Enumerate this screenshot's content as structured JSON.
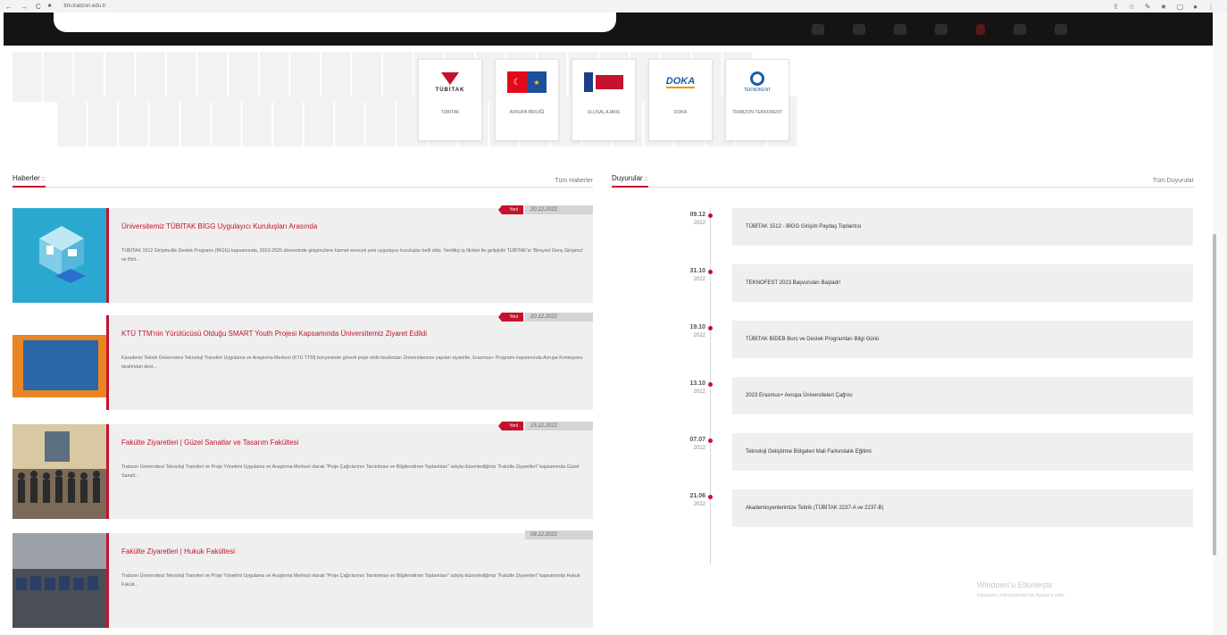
{
  "browser": {
    "back": "←",
    "forward": "→",
    "reload": "C",
    "url": "ttm.trabzon.edu.tr",
    "actions": [
      "⇪",
      "☆",
      "✎",
      "★",
      "▢",
      "●",
      "⋮"
    ]
  },
  "partners": [
    {
      "name": "tubitak",
      "logo_text": "TÜBİTAK",
      "label": "TÜBİTAK"
    },
    {
      "name": "eu",
      "logo_text": "C★",
      "label": "AVRUPA BİRLİĞİ"
    },
    {
      "name": "ua",
      "logo_text": "",
      "label": "ULUSAL AJANS"
    },
    {
      "name": "doka",
      "logo_text": "DOKA",
      "label": "DOKA"
    },
    {
      "name": "tt",
      "logo_text": "TEKNOKENT",
      "label": "TRABZON TEKNOKENT"
    }
  ],
  "news": {
    "title": "Haberler",
    "all_link": "Tüm Haberler",
    "new_label": "Yeni",
    "items": [
      {
        "title": "Üniversitemiz TÜBİTAK BİGG Uygulayıcı Kuruluşları Arasında",
        "excerpt": "TÜBİTAK 1512 Girişimcilik Destek Programı (BİGG) kapsamında, 2023-2025 döneminde girişimcilere hizmet verecek yeni uygulayıcı kuruluşlar belli oldu. Yenilikçi iş fikirleri ile geliştirilir TÜBİTAK'ın 'Bireysel Genç Girişimci' ve Birli...",
        "date": "20.12.2022",
        "new": true
      },
      {
        "title": "KTÜ TTM'nin Yürütücüsü Olduğu SMART Youth Projesi Kapsamında Üniversitemiz Ziyaret Edildi",
        "excerpt": "Karadeniz Teknik Üniversitesi Teknoloji Transferi Uygulama ve Araştırma Merkezi (KTÜ TTM) bünyesinde görevli proje ekibi tarafından Üniversitemize yapılan ziyarette, Erasmus+ Programı kapsamında Avrupa Komisyonu tarafından dest...",
        "date": "20.12.2022",
        "new": true
      },
      {
        "title": "Fakülte Ziyaretleri | Güzel Sanatlar ve Tasarım Fakültesi",
        "excerpt": "Trabzon Üniversitesi Teknoloji Transferi ve Proje Yönetimi Uygulama ve Araştırma Merkezi olarak \"Proje Çağrılarının Tanıtılması ve Bilgilendirme Toplantıları\" adıyla düzenlediğimiz \"Fakülte Ziyaretleri\" kapsamında Güzel Sanatl...",
        "date": "15.12.2022",
        "new": true
      },
      {
        "title": "Fakülte Ziyaretleri | Hukuk Fakültesi",
        "excerpt": "Trabzon Üniversitesi Teknoloji Transferi ve Proje Yönetimi Uygulama ve Araştırma Merkezi olarak \"Proje Çağrılarının Tanıtılması ve Bilgilendirme Toplantıları\" adıyla düzenlediğimiz \"Fakülte Ziyaretleri\" kapsamında Hukuk Fakült...",
        "date": "08.12.2022",
        "new": false
      }
    ]
  },
  "announcements": {
    "title": "Duyurular",
    "all_link": "Tüm Duyurular",
    "items": [
      {
        "day": "09.12",
        "year": "2022",
        "title": "TÜBİTAK 1512 - BİGG Girişim Paydaş Toplantısı"
      },
      {
        "day": "31.10",
        "year": "2022",
        "title": "TEKNOFEST 2023 Başvuruları Başladı!"
      },
      {
        "day": "19.10",
        "year": "2022",
        "title": "TÜBİTAK BİDEB Burs ve Destek Programları Bilgi Günü"
      },
      {
        "day": "13.10",
        "year": "2022",
        "title": "2023 Erasmus+ Avrupa Üniversiteleri Çağrısı"
      },
      {
        "day": "07.07",
        "year": "2022",
        "title": "Teknoloji Geliştirme Bölgeleri Mali Farkındalık Eğitimi"
      },
      {
        "day": "21.06",
        "year": "2022",
        "title": "Akademisyenlerimize Tebrik (TÜBİTAK 2237-A ve 2237-B)"
      }
    ]
  },
  "watermark": {
    "line1": "Windows'u Etkinleştir",
    "line2": "Windows'u etkinleştirmek için Ayarlar'a gidin."
  },
  "colors": {
    "accent": "#c4122f",
    "card": "#efefef",
    "header": "#141414"
  }
}
